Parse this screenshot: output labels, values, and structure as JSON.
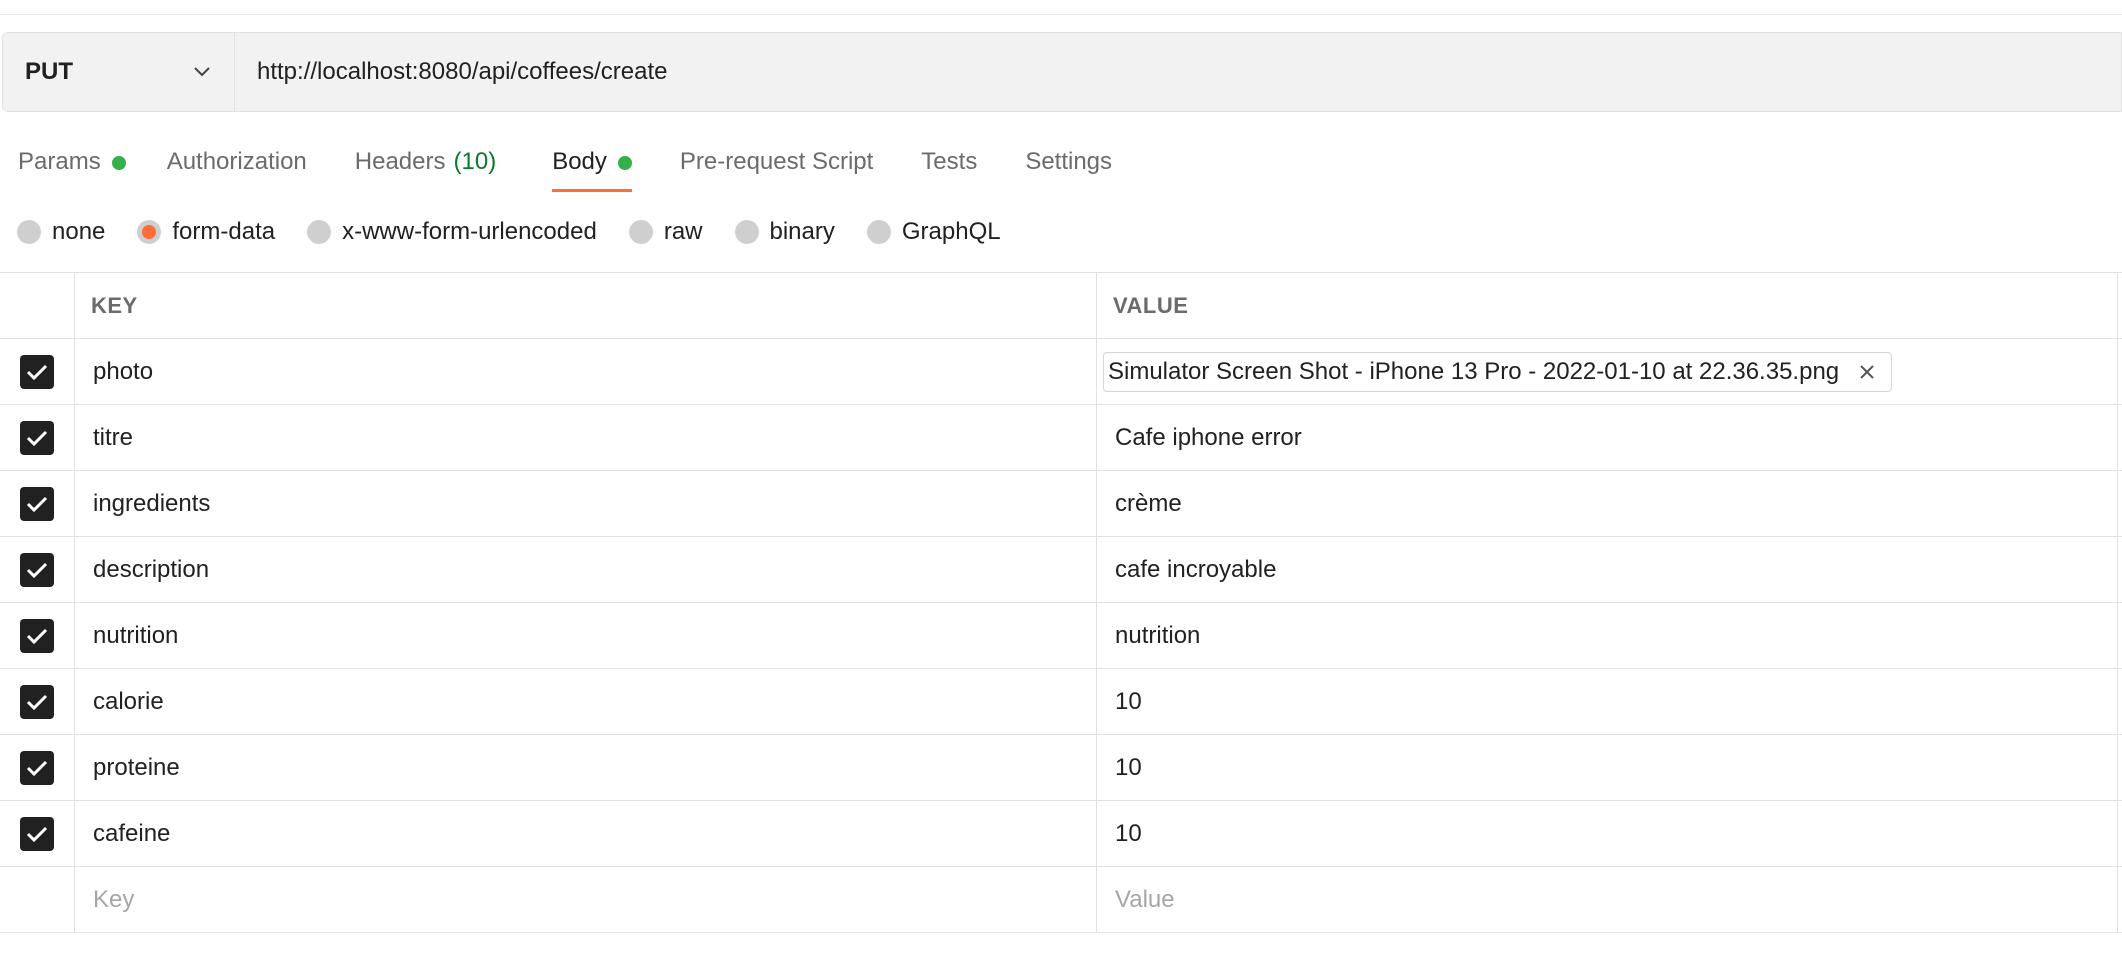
{
  "request": {
    "method": "PUT",
    "url": "http://localhost:8080/api/coffees/create"
  },
  "tabs": [
    {
      "label": "Params",
      "dot": true
    },
    {
      "label": "Authorization"
    },
    {
      "label": "Headers",
      "count": "(10)"
    },
    {
      "label": "Body",
      "dot": true,
      "active": true
    },
    {
      "label": "Pre-request Script"
    },
    {
      "label": "Tests"
    },
    {
      "label": "Settings"
    }
  ],
  "body_types": [
    {
      "label": "none"
    },
    {
      "label": "form-data",
      "selected": true
    },
    {
      "label": "x-www-form-urlencoded"
    },
    {
      "label": "raw"
    },
    {
      "label": "binary"
    },
    {
      "label": "GraphQL"
    }
  ],
  "table": {
    "headers": {
      "key": "KEY",
      "value": "VALUE"
    },
    "rows": [
      {
        "key": "photo",
        "value": "Simulator Screen Shot - iPhone 13 Pro - 2022-01-10 at 22.36.35.png",
        "is_file": true,
        "checked": true
      },
      {
        "key": "titre",
        "value": "Cafe iphone error",
        "checked": true
      },
      {
        "key": "ingredients",
        "value": "crème",
        "checked": true
      },
      {
        "key": "description",
        "value": "cafe incroyable",
        "checked": true
      },
      {
        "key": "nutrition",
        "value": "nutrition",
        "checked": true
      },
      {
        "key": "calorie",
        "value": "10",
        "checked": true
      },
      {
        "key": "proteine",
        "value": "10",
        "checked": true
      },
      {
        "key": "cafeine",
        "value": "10",
        "checked": true
      }
    ],
    "placeholder": {
      "key": "Key",
      "value": "Value"
    }
  },
  "colors": {
    "accent": "#ff6c37",
    "status_dot": "#34b04a",
    "count_green": "#0b7a2c"
  }
}
